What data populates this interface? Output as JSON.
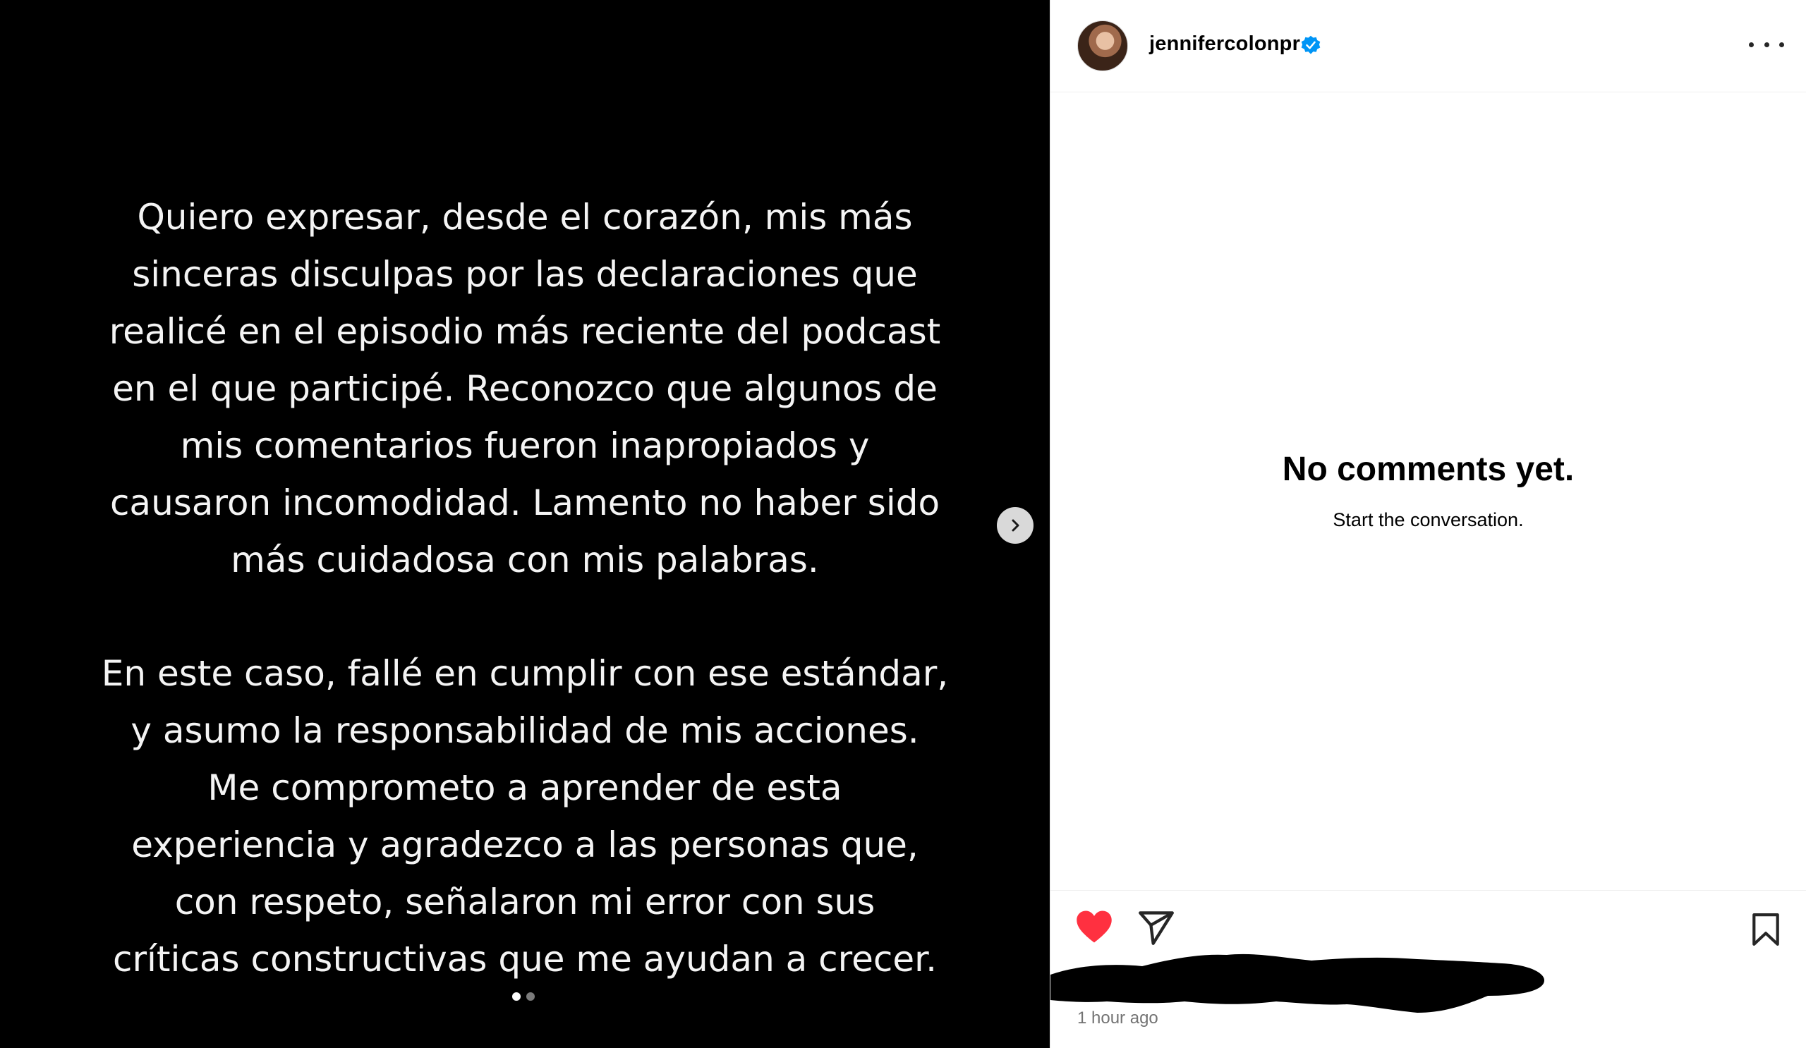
{
  "post": {
    "paragraph_1": [
      "Quiero expresar, desde el corazón, mis más",
      "sinceras disculpas por las declaraciones que",
      "realicé en el episodio más reciente del podcast",
      "en el que participé. Reconozco que algunos de",
      "mis comentarios fueron inapropiados y",
      "causaron incomodidad. Lamento no haber sido",
      "más cuidadosa con mis palabras."
    ],
    "paragraph_2": [
      "En este caso, fallé en cumplir con ese estándar,",
      "y asumo la responsabilidad de mis acciones.",
      "Me comprometo a aprender de esta",
      "experiencia y agradezco a las personas que,",
      "con respeto,  señalaron mi error con sus",
      "críticas constructivas que me ayudan a crecer."
    ],
    "carousel": {
      "count": 2,
      "active_index": 1
    }
  },
  "header": {
    "username": "jennifercolonpr",
    "verified": true
  },
  "comments": {
    "empty_title": "No comments yet.",
    "empty_subtitle": "Start the conversation."
  },
  "actions": {
    "liked": true,
    "like_color": "#ff3040"
  },
  "footer": {
    "timestamp": "1 hour ago"
  },
  "icons": [
    "chevron-right-icon",
    "verified-badge-icon",
    "more-options-icon",
    "heart-icon",
    "share-icon",
    "bookmark-icon"
  ]
}
